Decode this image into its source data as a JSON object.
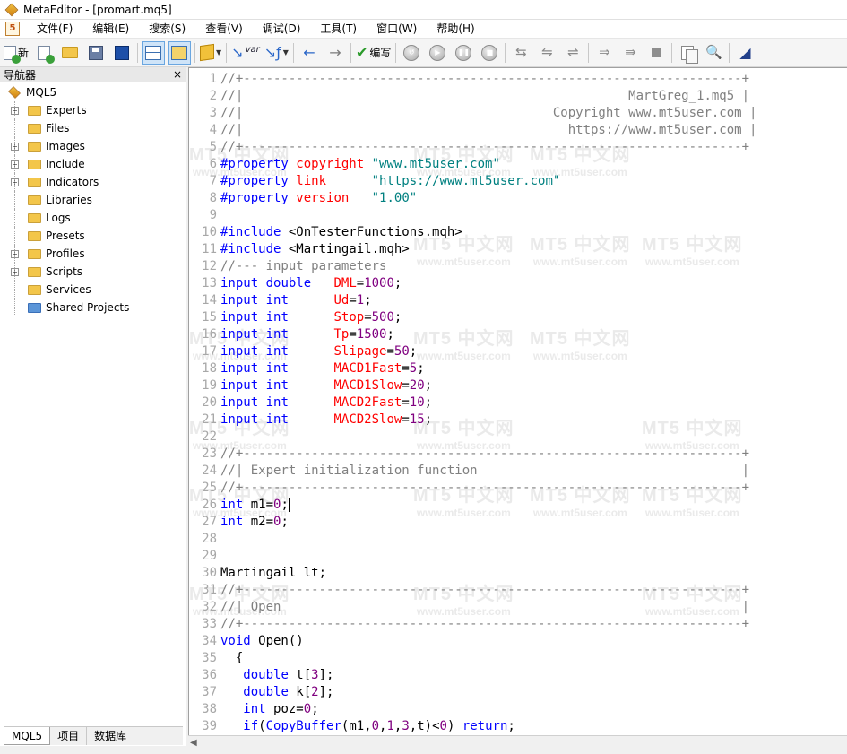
{
  "window": {
    "title": "MetaEditor - [promart.mq5]"
  },
  "menu": [
    "文件(F)",
    "编辑(E)",
    "搜索(S)",
    "查看(V)",
    "调试(D)",
    "工具(T)",
    "窗口(W)",
    "帮助(H)"
  ],
  "toolbar": {
    "new_label": "新",
    "compile_label": "编写",
    "var_label": "var"
  },
  "navigator": {
    "title": "导航器",
    "close": "×",
    "root": "MQL5",
    "items": [
      {
        "label": "Experts",
        "expandable": true,
        "icon": "folder-icon"
      },
      {
        "label": "Files",
        "expandable": false,
        "icon": "folder-icon"
      },
      {
        "label": "Images",
        "expandable": true,
        "icon": "folder-icon"
      },
      {
        "label": "Include",
        "expandable": true,
        "icon": "folder-icon"
      },
      {
        "label": "Indicators",
        "expandable": true,
        "icon": "folder-icon"
      },
      {
        "label": "Libraries",
        "expandable": false,
        "icon": "folder-icon"
      },
      {
        "label": "Logs",
        "expandable": false,
        "icon": "folder-icon"
      },
      {
        "label": "Presets",
        "expandable": false,
        "icon": "folder-icon"
      },
      {
        "label": "Profiles",
        "expandable": true,
        "icon": "folder-icon"
      },
      {
        "label": "Scripts",
        "expandable": true,
        "icon": "folder-icon"
      },
      {
        "label": "Services",
        "expandable": false,
        "icon": "folder-icon"
      },
      {
        "label": "Shared Projects",
        "expandable": false,
        "icon": "blue-folder-icon"
      }
    ],
    "tabs": [
      "MQL5",
      "项目",
      "数据库"
    ]
  },
  "watermark": {
    "line1": "MT5 中文网",
    "line2": "www.mt5user.com"
  },
  "code": [
    {
      "n": "1",
      "t": [
        [
          "cmt",
          "//+------------------------------------------------------------------+"
        ]
      ]
    },
    {
      "n": "2",
      "t": [
        [
          "cmt",
          "//|                                                   MartGreg_1.mq5 |"
        ]
      ]
    },
    {
      "n": "3",
      "t": [
        [
          "cmt",
          "//|                                         Copyright www.mt5user.com |"
        ]
      ]
    },
    {
      "n": "4",
      "t": [
        [
          "cmt",
          "//|                                           https://www.mt5user.com |"
        ]
      ]
    },
    {
      "n": "5",
      "t": [
        [
          "cmt",
          "//+------------------------------------------------------------------+"
        ]
      ]
    },
    {
      "n": "6",
      "t": [
        [
          "kw",
          "#property"
        ],
        [
          "",
          " "
        ],
        [
          "prop",
          "copyright"
        ],
        [
          "",
          " "
        ],
        [
          "str",
          "\"www.mt5user.com\""
        ]
      ]
    },
    {
      "n": "7",
      "t": [
        [
          "kw",
          "#property"
        ],
        [
          "",
          " "
        ],
        [
          "prop",
          "link"
        ],
        [
          "",
          "      "
        ],
        [
          "str",
          "\"https://www.mt5user.com\""
        ]
      ]
    },
    {
      "n": "8",
      "t": [
        [
          "kw",
          "#property"
        ],
        [
          "",
          " "
        ],
        [
          "prop",
          "version"
        ],
        [
          "",
          "   "
        ],
        [
          "str",
          "\"1.00\""
        ]
      ]
    },
    {
      "n": "9",
      "t": []
    },
    {
      "n": "10",
      "t": [
        [
          "kw",
          "#include"
        ],
        [
          "",
          " <OnTesterFunctions.mqh>"
        ]
      ]
    },
    {
      "n": "11",
      "t": [
        [
          "kw",
          "#include"
        ],
        [
          "",
          " <Martingail.mqh>"
        ]
      ]
    },
    {
      "n": "12",
      "t": [
        [
          "cmt",
          "//--- input parameters"
        ]
      ]
    },
    {
      "n": "13",
      "t": [
        [
          "kw",
          "input"
        ],
        [
          "",
          " "
        ],
        [
          "kw",
          "double"
        ],
        [
          "",
          "   "
        ],
        [
          "var",
          "DML"
        ],
        [
          "",
          "="
        ],
        [
          "num",
          "1000"
        ],
        [
          "",
          ";"
        ]
      ]
    },
    {
      "n": "14",
      "t": [
        [
          "kw",
          "input"
        ],
        [
          "",
          " "
        ],
        [
          "kw",
          "int"
        ],
        [
          "",
          "      "
        ],
        [
          "var",
          "Ud"
        ],
        [
          "",
          "="
        ],
        [
          "num",
          "1"
        ],
        [
          "",
          ";"
        ]
      ]
    },
    {
      "n": "15",
      "t": [
        [
          "kw",
          "input"
        ],
        [
          "",
          " "
        ],
        [
          "kw",
          "int"
        ],
        [
          "",
          "      "
        ],
        [
          "var",
          "Stop"
        ],
        [
          "",
          "="
        ],
        [
          "num",
          "500"
        ],
        [
          "",
          ";"
        ]
      ]
    },
    {
      "n": "16",
      "t": [
        [
          "kw",
          "input"
        ],
        [
          "",
          " "
        ],
        [
          "kw",
          "int"
        ],
        [
          "",
          "      "
        ],
        [
          "var",
          "Tp"
        ],
        [
          "",
          "="
        ],
        [
          "num",
          "1500"
        ],
        [
          "",
          ";"
        ]
      ]
    },
    {
      "n": "17",
      "t": [
        [
          "kw",
          "input"
        ],
        [
          "",
          " "
        ],
        [
          "kw",
          "int"
        ],
        [
          "",
          "      "
        ],
        [
          "var",
          "Slipage"
        ],
        [
          "",
          "="
        ],
        [
          "num",
          "50"
        ],
        [
          "",
          ";"
        ]
      ]
    },
    {
      "n": "18",
      "t": [
        [
          "kw",
          "input"
        ],
        [
          "",
          " "
        ],
        [
          "kw",
          "int"
        ],
        [
          "",
          "      "
        ],
        [
          "var",
          "MACD1Fast"
        ],
        [
          "",
          "="
        ],
        [
          "num",
          "5"
        ],
        [
          "",
          ";"
        ]
      ]
    },
    {
      "n": "19",
      "t": [
        [
          "kw",
          "input"
        ],
        [
          "",
          " "
        ],
        [
          "kw",
          "int"
        ],
        [
          "",
          "      "
        ],
        [
          "var",
          "MACD1Slow"
        ],
        [
          "",
          "="
        ],
        [
          "num",
          "20"
        ],
        [
          "",
          ";"
        ]
      ]
    },
    {
      "n": "20",
      "t": [
        [
          "kw",
          "input"
        ],
        [
          "",
          " "
        ],
        [
          "kw",
          "int"
        ],
        [
          "",
          "      "
        ],
        [
          "var",
          "MACD2Fast"
        ],
        [
          "",
          "="
        ],
        [
          "num",
          "10"
        ],
        [
          "",
          ";"
        ]
      ]
    },
    {
      "n": "21",
      "t": [
        [
          "kw",
          "input"
        ],
        [
          "",
          " "
        ],
        [
          "kw",
          "int"
        ],
        [
          "",
          "      "
        ],
        [
          "var",
          "MACD2Slow"
        ],
        [
          "",
          "="
        ],
        [
          "num",
          "15"
        ],
        [
          "",
          ";"
        ]
      ]
    },
    {
      "n": "22",
      "t": []
    },
    {
      "n": "23",
      "t": [
        [
          "cmt",
          "//+------------------------------------------------------------------+"
        ]
      ]
    },
    {
      "n": "24",
      "t": [
        [
          "cmt",
          "//| Expert initialization function                                   |"
        ]
      ]
    },
    {
      "n": "25",
      "t": [
        [
          "cmt",
          "//+------------------------------------------------------------------+"
        ]
      ]
    },
    {
      "n": "26",
      "t": [
        [
          "kw",
          "int"
        ],
        [
          "",
          " m1="
        ],
        [
          "num",
          "0"
        ],
        [
          "",
          ";"
        ]
      ],
      "cursor": true
    },
    {
      "n": "27",
      "t": [
        [
          "kw",
          "int"
        ],
        [
          "",
          " m2="
        ],
        [
          "num",
          "0"
        ],
        [
          "",
          ";"
        ]
      ]
    },
    {
      "n": "28",
      "t": []
    },
    {
      "n": "29",
      "t": []
    },
    {
      "n": "30",
      "t": [
        [
          "",
          "Martingail lt;"
        ]
      ]
    },
    {
      "n": "31",
      "t": [
        [
          "cmt",
          "//+------------------------------------------------------------------+"
        ]
      ]
    },
    {
      "n": "32",
      "t": [
        [
          "cmt",
          "//| Open                                                             |"
        ]
      ]
    },
    {
      "n": "33",
      "t": [
        [
          "cmt",
          "//+------------------------------------------------------------------+"
        ]
      ]
    },
    {
      "n": "34",
      "t": [
        [
          "kw",
          "void"
        ],
        [
          "",
          " Open()"
        ]
      ]
    },
    {
      "n": "35",
      "t": [
        [
          "",
          "  {"
        ]
      ]
    },
    {
      "n": "36",
      "t": [
        [
          "",
          "   "
        ],
        [
          "kw",
          "double"
        ],
        [
          "",
          " t["
        ],
        [
          "num",
          "3"
        ],
        [
          "",
          "];"
        ]
      ]
    },
    {
      "n": "37",
      "t": [
        [
          "",
          "   "
        ],
        [
          "kw",
          "double"
        ],
        [
          "",
          " k["
        ],
        [
          "num",
          "2"
        ],
        [
          "",
          "];"
        ]
      ]
    },
    {
      "n": "38",
      "t": [
        [
          "",
          "   "
        ],
        [
          "kw",
          "int"
        ],
        [
          "",
          " poz="
        ],
        [
          "num",
          "0"
        ],
        [
          "",
          ";"
        ]
      ]
    },
    {
      "n": "39",
      "t": [
        [
          "",
          "   "
        ],
        [
          "kw",
          "if"
        ],
        [
          "",
          "("
        ],
        [
          "kw",
          "CopyBuffer"
        ],
        [
          "",
          "(m1,"
        ],
        [
          "num",
          "0"
        ],
        [
          "",
          ","
        ],
        [
          "num",
          "1"
        ],
        [
          "",
          ","
        ],
        [
          "num",
          "3"
        ],
        [
          "",
          ",t)<"
        ],
        [
          "num",
          "0"
        ],
        [
          "",
          ") "
        ],
        [
          "kw",
          "return"
        ],
        [
          "",
          ";"
        ]
      ]
    }
  ]
}
